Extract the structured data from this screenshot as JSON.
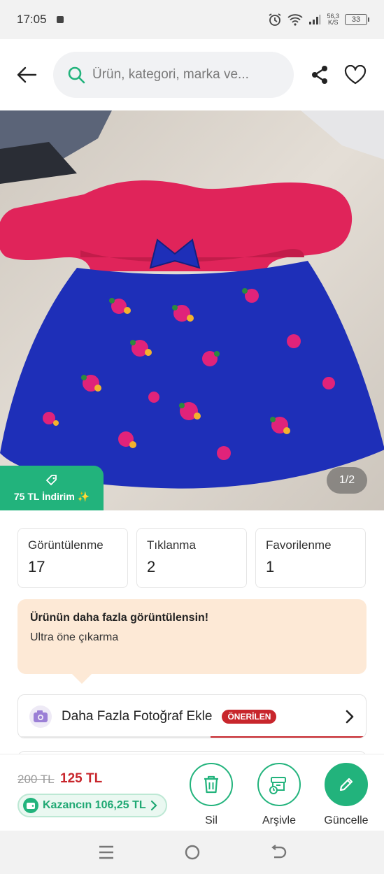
{
  "status_bar": {
    "time": "17:05",
    "speed_value": "56,3",
    "speed_unit": "K/S",
    "battery": "33"
  },
  "header": {
    "search_placeholder": "Ürün, kategori, marka ve...",
    "icons": [
      "back-arrow-icon",
      "search-icon",
      "share-icon",
      "heart-icon"
    ]
  },
  "product_image": {
    "discount_label": "75 TL İndirim ✨",
    "page_indicator": "1/2"
  },
  "stats": [
    {
      "label": "Görüntülenme",
      "value": "17"
    },
    {
      "label": "Tıklanma",
      "value": "2"
    },
    {
      "label": "Favorilenme",
      "value": "1"
    }
  ],
  "promo": {
    "title": "Ürünün daha fazla görüntülensin!",
    "subtitle": "Ultra öne çıkarma"
  },
  "suggestion": {
    "label": "Daha Fazla Fotoğraf Ekle",
    "badge": "ÖNERİLEN",
    "progress": 0.5
  },
  "bottom_bar": {
    "old_price": "200 TL",
    "new_price": "125 TL",
    "earnings": "Kazancın 106,25 TL",
    "actions": [
      {
        "label": "Sil",
        "icon": "trash-icon"
      },
      {
        "label": "Arşivle",
        "icon": "archive-icon"
      },
      {
        "label": "Güncelle",
        "icon": "pencil-icon"
      }
    ]
  },
  "colors": {
    "brand_green": "#22b37c",
    "price_red": "#c8262c",
    "promo_bg": "#fde9d6",
    "dress_pink": "#e0245a",
    "dress_blue": "#1e2fb8"
  }
}
